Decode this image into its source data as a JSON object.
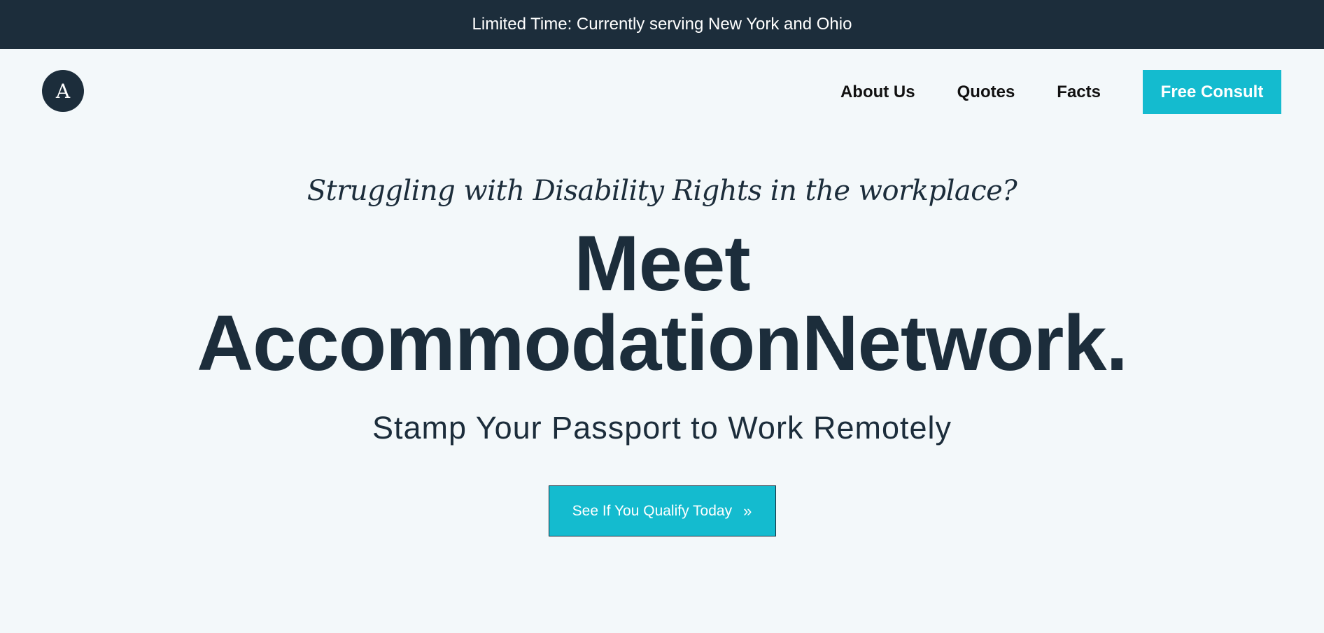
{
  "announcement": {
    "text": "Limited Time: Currently serving New York and Ohio"
  },
  "header": {
    "logo_letter": "A",
    "nav": [
      {
        "label": "About Us"
      },
      {
        "label": "Quotes"
      },
      {
        "label": "Facts"
      }
    ],
    "cta_label": "Free Consult"
  },
  "hero": {
    "tagline": "Struggling with Disability Rights in the workplace?",
    "headline_line1": "Meet",
    "headline_line2": "AccommodationNetwork.",
    "subheadline": "Stamp Your Passport to Work Remotely",
    "cta_label": "See If You Qualify Today",
    "cta_icon": "double-chevron-right-icon"
  },
  "colors": {
    "background": "#f3f8fa",
    "dark_navy": "#1c2d3b",
    "accent_teal": "#14bbcf"
  }
}
